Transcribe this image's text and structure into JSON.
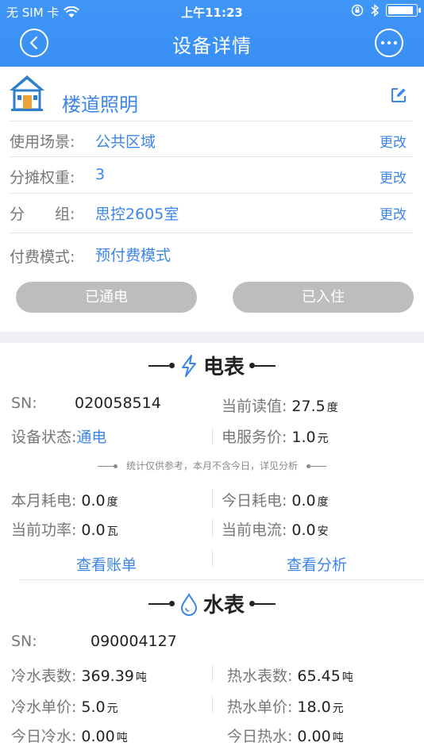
{
  "status_bar": {
    "carrier": "无 SIM 卡",
    "time": "上午11:23",
    "battery_level": 0.95
  },
  "nav": {
    "title": "设备详情",
    "back_icon": "back-arrow-icon",
    "more_icon": "more-icon"
  },
  "device": {
    "name": "楼道照明",
    "icon": "house-icon",
    "edit_icon": "edit-icon"
  },
  "info_rows": [
    {
      "label": "使用场景:",
      "value": "公共区域",
      "action": "更改"
    },
    {
      "label": "分摊权重:",
      "value": "3",
      "action": "更改"
    },
    {
      "label": "分　　组:",
      "value": "思控2605室",
      "action": "更改"
    },
    {
      "label": "付费模式:",
      "value": "预付费模式",
      "action": ""
    }
  ],
  "status_buttons": {
    "power": "已通电",
    "occupancy": "已入住"
  },
  "electric_meter": {
    "title": "电表",
    "icon": "lightning-icon",
    "sn_label": "SN:",
    "sn_value": "020058514",
    "reading_label": "当前读值:",
    "reading_value": "27.5",
    "reading_unit": "度",
    "status_label": "设备状态:",
    "status_value": "通电",
    "service_price_label": "电服务价:",
    "service_price_value": "1.0",
    "service_price_unit": "元",
    "note": "统计仅供参考，本月不含今日，详见分析",
    "month_label": "本月耗电:",
    "month_value": "0.0",
    "month_unit": "度",
    "today_label": "今日耗电:",
    "today_value": "0.0",
    "today_unit": "度",
    "power_label": "当前功率:",
    "power_value": "0.0",
    "power_unit": "瓦",
    "current_label": "当前电流:",
    "current_value": "0.0",
    "current_unit": "安",
    "bill_link": "查看账单",
    "analysis_link": "查看分析"
  },
  "water_meter": {
    "title": "水表",
    "icon": "water-drop-icon",
    "sn_label": "SN:",
    "sn_value": "090004127",
    "cold_reading_label": "冷水表数:",
    "cold_reading_value": "369.39",
    "cold_reading_unit": "吨",
    "hot_reading_label": "热水表数:",
    "hot_reading_value": "65.45",
    "hot_reading_unit": "吨",
    "cold_price_label": "冷水单价:",
    "cold_price_value": "5.0",
    "cold_price_unit": "元",
    "hot_price_label": "热水单价:",
    "hot_price_value": "18.0",
    "hot_price_unit": "元",
    "today_cold_label": "今日冷水:",
    "today_cold_value": "0.00",
    "today_cold_unit": "吨",
    "today_hot_label": "今日热水:",
    "today_hot_value": "0.00",
    "today_hot_unit": "吨"
  },
  "colors": {
    "primary": "#3b8ff3",
    "link": "#3b86e6",
    "disabled_button": "#bdbdbd"
  }
}
